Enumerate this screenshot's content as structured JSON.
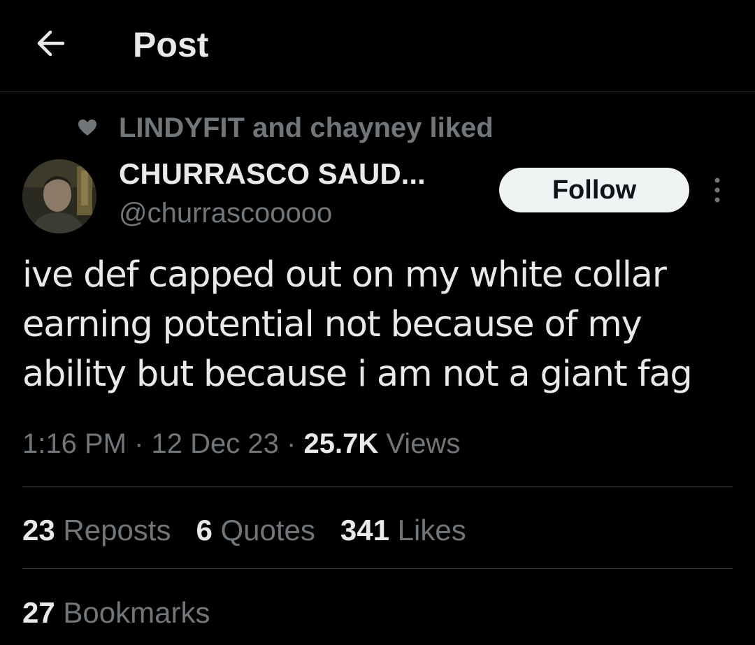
{
  "header": {
    "title": "Post",
    "back_icon": "arrow-left-icon"
  },
  "social_context": {
    "icon": "heart-icon",
    "text": "LINDYFIT and chayney liked"
  },
  "author": {
    "display_name": "CHURRASCO SAUD...",
    "handle": "@churrascooooo",
    "avatar": "avatar"
  },
  "follow_button": {
    "label": "Follow"
  },
  "more_icon": "more-vertical-icon",
  "tweet": {
    "text": "ive def capped out on my white collar earning potential not because of my ability but because i am not a giant fag"
  },
  "meta": {
    "time": "1:16 PM",
    "separator": "·",
    "date": "12 Dec 23",
    "views_count": "25.7K",
    "views_label": "Views"
  },
  "stats": {
    "reposts_count": "23",
    "reposts_label": "Reposts",
    "quotes_count": "6",
    "quotes_label": "Quotes",
    "likes_count": "341",
    "likes_label": "Likes",
    "bookmarks_count": "27",
    "bookmarks_label": "Bookmarks"
  },
  "colors": {
    "background": "#000000",
    "primary_text": "#e7e9ea",
    "secondary_text": "#71767b",
    "divider": "#2f3336",
    "button_bg": "#eff3f4"
  }
}
